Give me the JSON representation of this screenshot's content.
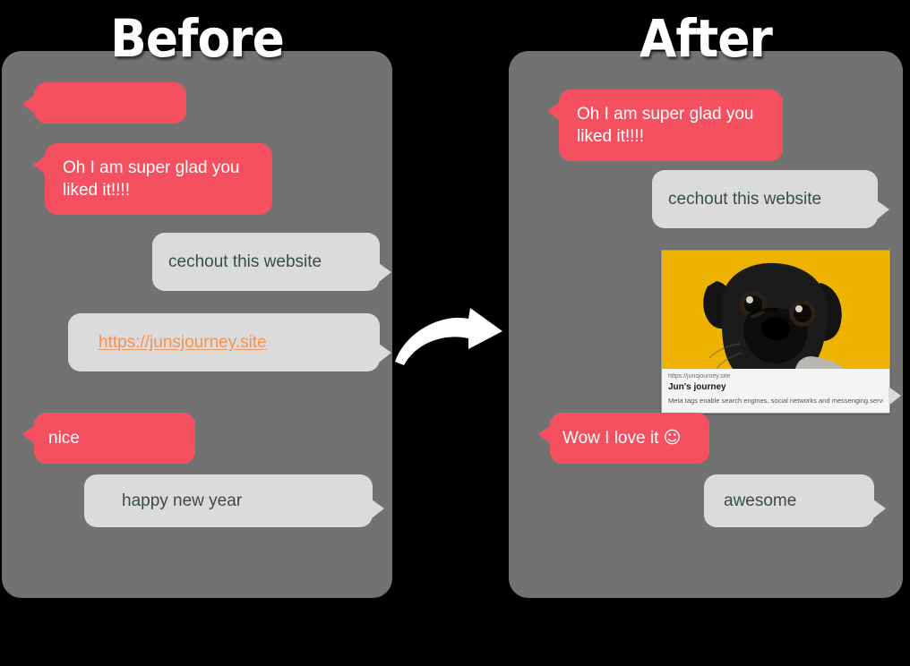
{
  "titles": {
    "before": "Before",
    "after": "After"
  },
  "colors": {
    "panel_bg": "#727272",
    "bubble_sent": "#F4505F",
    "bubble_received": "#DBDBDB",
    "bubble_received_text": "#3B4C4C",
    "link": "#F59350",
    "preview_image_bg": "#EEB300",
    "page_bg": "#000000",
    "title_text": "#FFFFFF"
  },
  "before_panel": {
    "messages": [
      {
        "id": "msg-empty-red",
        "side": "left",
        "type": "red",
        "text": ""
      },
      {
        "id": "msg-glad",
        "side": "left",
        "type": "red",
        "text": "Oh I am super glad you liked it!!!!"
      },
      {
        "id": "msg-cechout",
        "side": "right",
        "type": "gray",
        "text": "cechout this website"
      },
      {
        "id": "msg-link",
        "side": "right",
        "type": "gray",
        "text": "https://junsjourney.site",
        "is_link": true
      },
      {
        "id": "msg-nice",
        "side": "left",
        "type": "red",
        "text": "nice"
      },
      {
        "id": "msg-happy-new-year",
        "side": "right",
        "type": "gray",
        "text": "happy new year"
      }
    ]
  },
  "after_panel": {
    "messages": [
      {
        "id": "msg-glad-2",
        "side": "left",
        "type": "red",
        "text": "Oh I am super glad you liked it!!!!"
      },
      {
        "id": "msg-cechout-2",
        "side": "right",
        "type": "gray",
        "text": "cechout this website"
      },
      {
        "id": "msg-wow",
        "side": "left",
        "type": "red",
        "text": "Wow I love it",
        "emoji": "☺"
      },
      {
        "id": "msg-awesome",
        "side": "right",
        "type": "gray",
        "text": "awesome"
      }
    ],
    "link_preview": {
      "url": "https://junsjourney.site",
      "title": "Jun's journey",
      "description": "Meta tags enable search engines, social networks and messenging servic...",
      "image_alt": "black-pug-on-yellow-background"
    }
  },
  "arrow": {
    "icon": "curved-right-arrow"
  }
}
